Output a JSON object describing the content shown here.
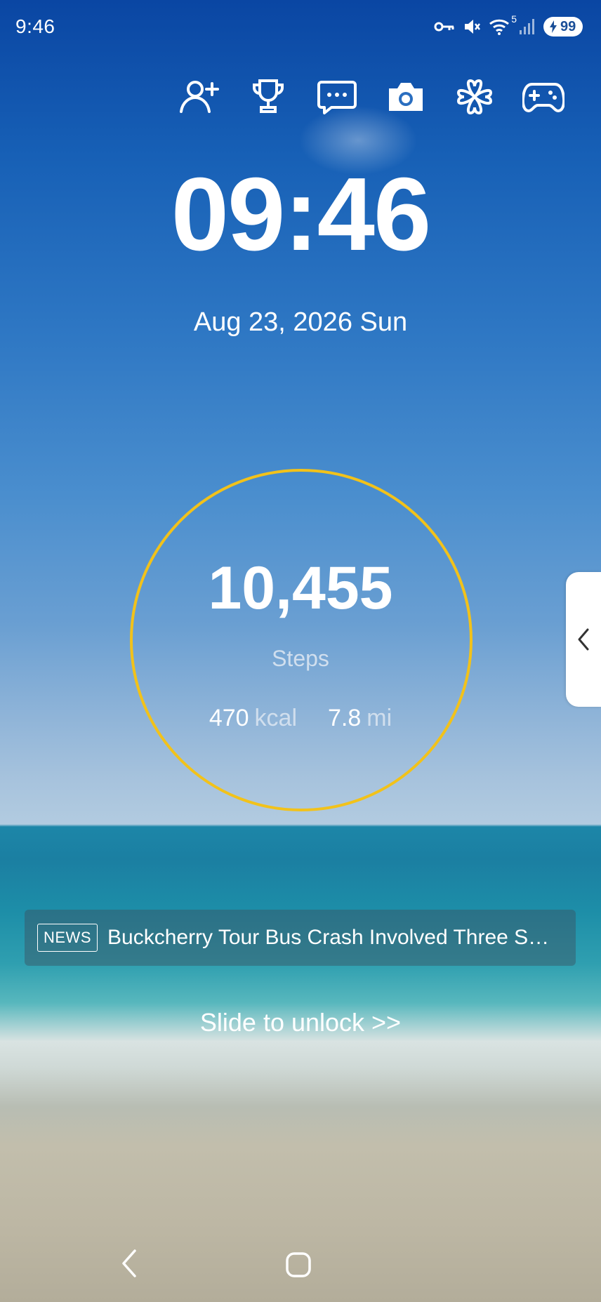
{
  "status_bar": {
    "time": "9:46",
    "wifi_superscript": "5",
    "battery": "99",
    "icons": [
      "key-icon",
      "mute-icon",
      "wifi-icon",
      "signal-icon",
      "battery-icon"
    ]
  },
  "shortcuts": [
    {
      "name": "add-friend-icon"
    },
    {
      "name": "trophy-icon"
    },
    {
      "name": "message-icon"
    },
    {
      "name": "camera-icon"
    },
    {
      "name": "clover-icon"
    },
    {
      "name": "gamepad-icon"
    }
  ],
  "clock": {
    "time": "09:46",
    "date": "Aug 23, 2026 Sun"
  },
  "steps": {
    "count": "10,455",
    "label": "Steps",
    "kcal_value": "470",
    "kcal_unit": "kcal",
    "distance_value": "7.8",
    "distance_unit": "mi",
    "ring_color": "#f2c21a"
  },
  "news": {
    "badge": "NEWS",
    "headline": "Buckcherry Tour Bus Crash Involved Three Se..."
  },
  "unlock": {
    "label": "Slide to unlock >>"
  }
}
